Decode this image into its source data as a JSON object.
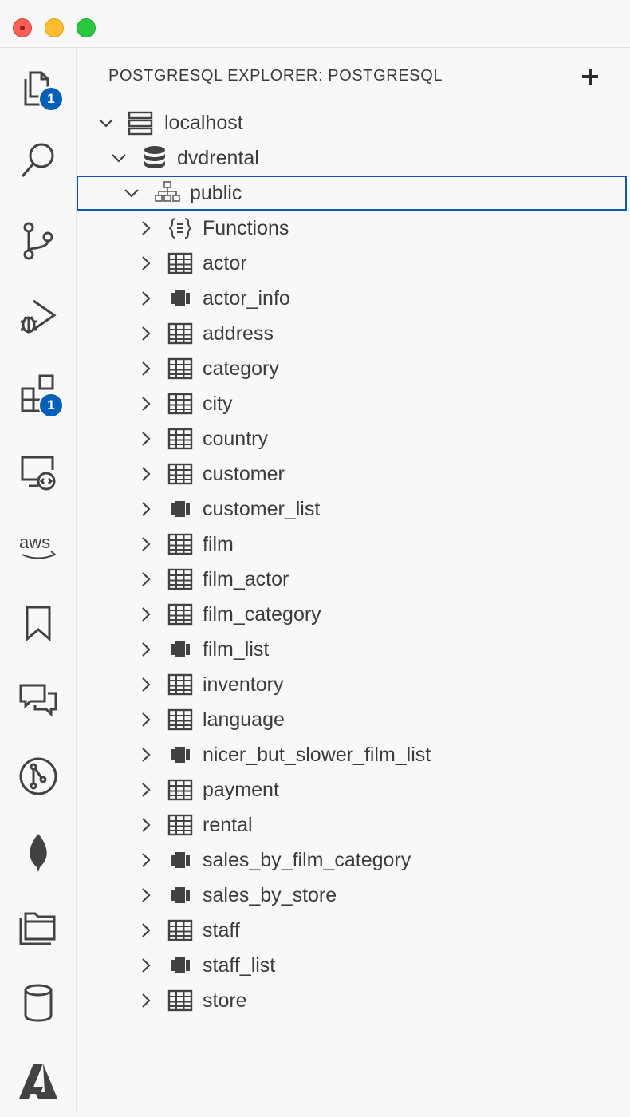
{
  "activity_bar": {
    "explorer_badge": "1",
    "extensions_badge": "1",
    "aws_label": "aws"
  },
  "sidebar": {
    "title": "POSTGRESQL EXPLORER: POSTGRESQL"
  },
  "tree": {
    "server": "localhost",
    "database": "dvdrental",
    "schema": "public",
    "items": [
      {
        "label": "Functions",
        "kind": "function"
      },
      {
        "label": "actor",
        "kind": "table"
      },
      {
        "label": "actor_info",
        "kind": "view"
      },
      {
        "label": "address",
        "kind": "table"
      },
      {
        "label": "category",
        "kind": "table"
      },
      {
        "label": "city",
        "kind": "table"
      },
      {
        "label": "country",
        "kind": "table"
      },
      {
        "label": "customer",
        "kind": "table"
      },
      {
        "label": "customer_list",
        "kind": "view"
      },
      {
        "label": "film",
        "kind": "table"
      },
      {
        "label": "film_actor",
        "kind": "table"
      },
      {
        "label": "film_category",
        "kind": "table"
      },
      {
        "label": "film_list",
        "kind": "view"
      },
      {
        "label": "inventory",
        "kind": "table"
      },
      {
        "label": "language",
        "kind": "table"
      },
      {
        "label": "nicer_but_slower_film_list",
        "kind": "view"
      },
      {
        "label": "payment",
        "kind": "table"
      },
      {
        "label": "rental",
        "kind": "table"
      },
      {
        "label": "sales_by_film_category",
        "kind": "view"
      },
      {
        "label": "sales_by_store",
        "kind": "view"
      },
      {
        "label": "staff",
        "kind": "table"
      },
      {
        "label": "staff_list",
        "kind": "view"
      },
      {
        "label": "store",
        "kind": "table"
      }
    ]
  },
  "colors": {
    "accent": "#005fb8",
    "selection_border": "#0a5aa8",
    "icon": "#424242",
    "text": "#3b3b3b"
  }
}
